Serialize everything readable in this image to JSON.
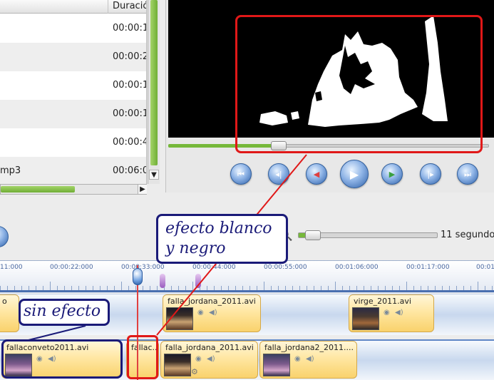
{
  "file_list": {
    "column_header": "Duració",
    "rows": [
      {
        "name": "",
        "duration": "00:00:1"
      },
      {
        "name": "",
        "duration": "00:00:2"
      },
      {
        "name": "",
        "duration": "00:00:1"
      },
      {
        "name": "",
        "duration": "00:00:1"
      },
      {
        "name": "",
        "duration": "00:00:4"
      },
      {
        "name": "mp3",
        "duration": "00:06:0"
      }
    ]
  },
  "zoom": {
    "label": "11 segundo"
  },
  "timeline": {
    "ruler_labels": [
      "11:000",
      "00:00:22:000",
      "00:00:33:000",
      "00:00:44:000",
      "00:00:55:000",
      "00:01:06:000",
      "00:01:17:000",
      "00:01"
    ],
    "track1_clips": [
      {
        "title": "o"
      },
      {
        "title": "falla_jordana_2011.avi"
      },
      {
        "title": "virge_2011.avi"
      }
    ],
    "track2_clips": [
      {
        "title": "fallaconveto2011.avi"
      },
      {
        "title": "fallac..."
      },
      {
        "title": "falla_jordana_2011.avi"
      },
      {
        "title": "falla_jordana2_2011...."
      }
    ]
  },
  "annotations": {
    "effect_line1": "efecto blanco",
    "effect_line2": "y negro",
    "no_effect": "sin efecto"
  },
  "colors": {
    "annotation_red": "#e01818",
    "annotation_navy": "#1a1a78",
    "accent_green": "#76b83a",
    "clip_yellow": "#f9d26c"
  }
}
